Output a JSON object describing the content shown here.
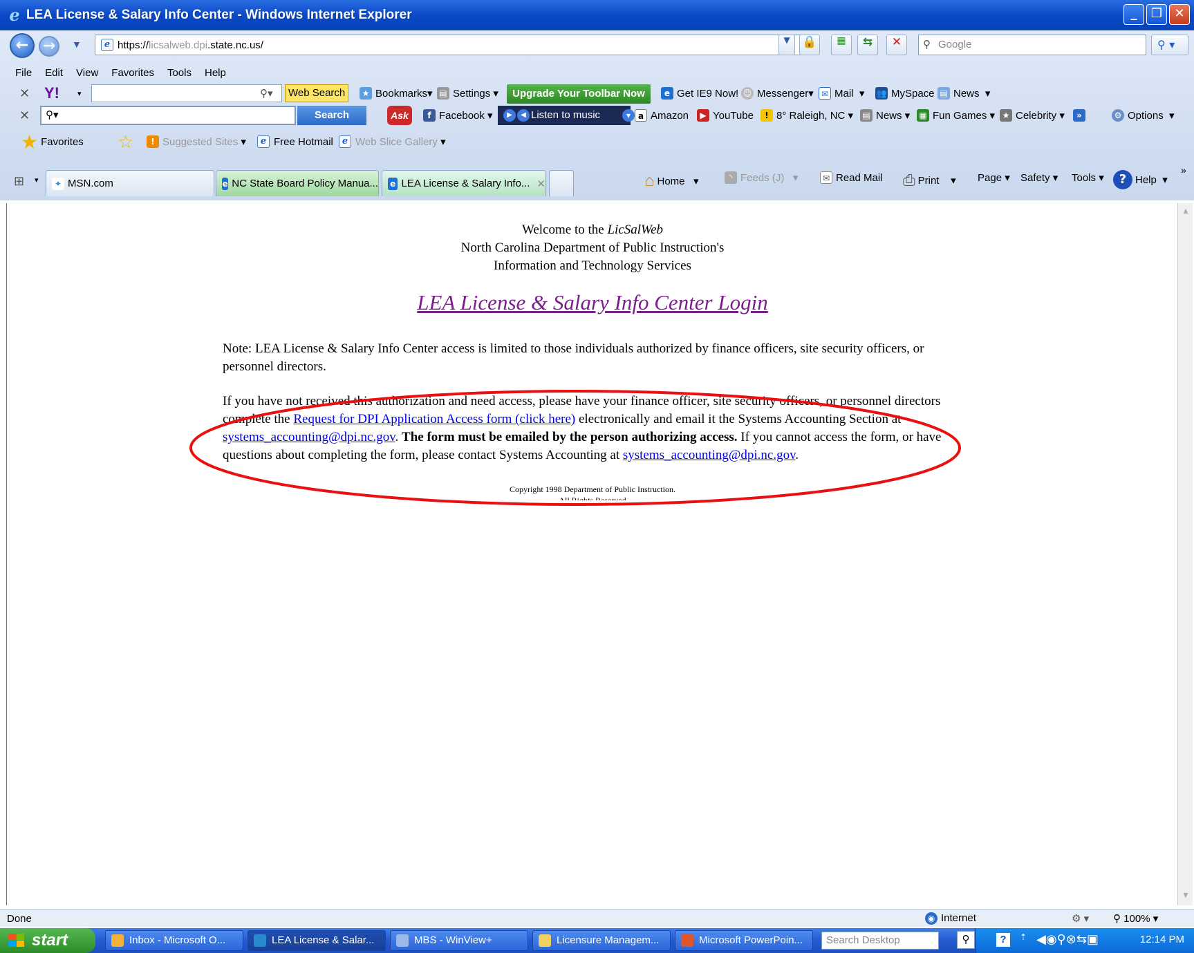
{
  "window": {
    "title": "LEA License & Salary Info Center - Windows Internet Explorer"
  },
  "address": {
    "url_prefix": "https://",
    "url_host": "licsalweb.dpi",
    "url_rest": ".state.nc.us/"
  },
  "google_search": {
    "placeholder": "Google"
  },
  "menu": [
    "File",
    "Edit",
    "View",
    "Favorites",
    "Tools",
    "Help"
  ],
  "yahoo_toolbar": {
    "web_search": "Web Search",
    "bookmarks": "Bookmarks",
    "settings": "Settings",
    "upgrade": "Upgrade Your Toolbar Now",
    "get_ie9": "Get IE9 Now!",
    "messenger": "Messenger",
    "mail": "Mail",
    "myspace": "MySpace",
    "news": "News"
  },
  "search_toolbar": {
    "search_button": "Search",
    "ask": "Ask",
    "facebook": "Facebook",
    "listen": "Listen to music",
    "amazon": "Amazon",
    "youtube": "YouTube",
    "weather": "8° Raleigh, NC",
    "news": "News",
    "fun_games": "Fun Games",
    "celebrity": "Celebrity",
    "options": "Options"
  },
  "favorites_bar": {
    "favorites": "Favorites",
    "suggested": "Suggested Sites",
    "hotmail": "Free Hotmail",
    "webslice": "Web Slice Gallery"
  },
  "tabs": [
    {
      "label": "MSN.com"
    },
    {
      "label": "NC State Board Policy Manua..."
    },
    {
      "label": "LEA License & Salary Info..."
    }
  ],
  "command_bar": {
    "home": "Home",
    "feeds": "Feeds (J)",
    "read_mail": "Read Mail",
    "print": "Print",
    "page": "Page",
    "safety": "Safety",
    "tools": "Tools",
    "help": "Help"
  },
  "page": {
    "welcome_prefix": "Welcome to the ",
    "welcome_name": "LicSalWeb",
    "line2": "North Carolina Department of Public Instruction's",
    "line3": "Information and Technology Services",
    "heading": "LEA License & Salary Info Center Login",
    "note": "Note: LEA License & Salary Info Center access is limited to those individuals authorized by finance officers, site security officers, or personnel directors.",
    "p2_a": "If you have not received this authorization and need access, please have your finance officer, site security officers, or personnel directors complete the ",
    "p2_link": "Request for DPI Application Access form (click here)",
    "p2_b": " electronically and email it the Systems Accounting Section at ",
    "email": "systems_accounting@dpi.nc.gov",
    "p2_c": ". ",
    "p2_bold": "The form must be emailed by the person authorizing access.",
    "p2_d": " If you cannot access the form, or have questions about completing the form, please contact Systems Accounting at ",
    "p2_e": ".",
    "copyright": "Copyright 1998 Department of Public Instruction.",
    "rights": "All Rights Reserved"
  },
  "annotation": {
    "color": "#e81010"
  },
  "status": {
    "text": "Done",
    "zone": "Internet",
    "zoom": "100%"
  },
  "taskbar": {
    "start": "start",
    "items": [
      "Inbox - Microsoft O...",
      "LEA License & Salar...",
      "MBS - WinView+",
      "Licensure Managem...",
      "Microsoft PowerPoin..."
    ],
    "search_placeholder": "Search Desktop",
    "clock": "12:14 PM"
  }
}
